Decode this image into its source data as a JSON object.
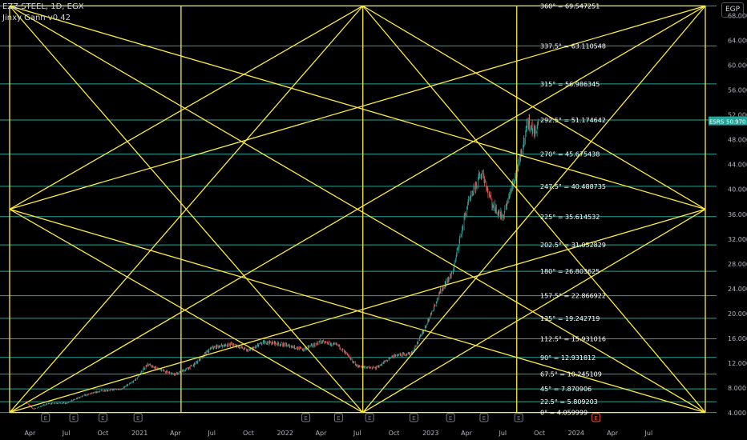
{
  "header": {
    "symbol_line": "EZZ STEEL, 1D, EGX",
    "indicator_name": "Jinxy Gann v0.42",
    "currency_button": "EGP"
  },
  "price_label": {
    "tag": "ESRS",
    "value": "50.970"
  },
  "colors": {
    "background": "#000000",
    "gann_lines": "#ffeb3b",
    "levels": "#26a69a",
    "candle_up": "#26a69a",
    "candle_down": "#ef5350",
    "label_bg": "#26a69a",
    "earnings_marker": "#787b86",
    "earnings_marker_future": "#ef5350"
  },
  "chart_data": {
    "type": "candlestick",
    "title": "EZZ STEEL, 1D, EGX",
    "ylabel": "EGP",
    "y_axis_ticks": [
      "4.000",
      "8.000",
      "12.000",
      "16.000",
      "20.000",
      "24.000",
      "28.000",
      "32.000",
      "36.000",
      "40.000",
      "44.000",
      "48.000",
      "52.000",
      "56.000",
      "60.000",
      "64.000",
      "68.000"
    ],
    "x_axis_ticks": [
      "Apr",
      "Jul",
      "Oct",
      "2021",
      "Apr",
      "Jul",
      "Oct",
      "2022",
      "Apr",
      "Jul",
      "Oct",
      "2023",
      "Apr",
      "Jul",
      "Oct",
      "2024",
      "Apr",
      "Jul"
    ],
    "ylim": [
      3.5,
      70.5
    ],
    "grid": false,
    "gann_levels": [
      {
        "label": "0° = 4.059999",
        "value": 4.06
      },
      {
        "label": "22.5° = 5.809203",
        "value": 5.81
      },
      {
        "label": "45° = 7.870906",
        "value": 7.87
      },
      {
        "label": "67.5° = 10.245109",
        "value": 10.25
      },
      {
        "label": "90° = 12.931812",
        "value": 12.93
      },
      {
        "label": "112.5° = 15.931016",
        "value": 15.93
      },
      {
        "label": "135° = 19.242719",
        "value": 19.24
      },
      {
        "label": "157.5° = 22.866922",
        "value": 22.87
      },
      {
        "label": "180° = 26.803625",
        "value": 26.8
      },
      {
        "label": "202.5° = 31.052829",
        "value": 31.05
      },
      {
        "label": "225° = 35.614532",
        "value": 35.61
      },
      {
        "label": "247.5° = 40.488735",
        "value": 40.49
      },
      {
        "label": "270° = 45.675438",
        "value": 45.68
      },
      {
        "label": "292.5° = 51.174642",
        "value": 51.17
      },
      {
        "label": "315° = 56.986345",
        "value": 56.99
      },
      {
        "label": "337.5° = 63.110548",
        "value": 63.11
      },
      {
        "label": "360° = 69.547251",
        "value": 69.55
      }
    ],
    "price_path": [
      [
        "2020-03-20",
        5.8
      ],
      [
        "2020-04-10",
        4.6
      ],
      [
        "2020-05-15",
        5.5
      ],
      [
        "2020-07-01",
        5.6
      ],
      [
        "2020-08-15",
        6.8
      ],
      [
        "2020-10-01",
        7.6
      ],
      [
        "2020-11-15",
        7.8
      ],
      [
        "2020-12-20",
        9.2
      ],
      [
        "2021-01-20",
        11.8
      ],
      [
        "2021-02-20",
        11.0
      ],
      [
        "2021-04-01",
        10.2
      ],
      [
        "2021-05-15",
        11.6
      ],
      [
        "2021-07-01",
        14.5
      ],
      [
        "2021-08-20",
        15.1
      ],
      [
        "2021-10-01",
        14.0
      ],
      [
        "2021-11-10",
        15.4
      ],
      [
        "2022-01-01",
        15.0
      ],
      [
        "2022-02-15",
        14.2
      ],
      [
        "2022-04-01",
        15.5
      ],
      [
        "2022-05-15",
        14.8
      ],
      [
        "2022-07-01",
        11.5
      ],
      [
        "2022-08-15",
        11.2
      ],
      [
        "2022-10-01",
        13.2
      ],
      [
        "2022-11-15",
        13.6
      ],
      [
        "2022-12-20",
        18.0
      ],
      [
        "2023-01-25",
        23.5
      ],
      [
        "2023-02-25",
        26.5
      ],
      [
        "2023-04-01",
        37.0
      ],
      [
        "2023-05-10",
        43.0
      ],
      [
        "2023-06-05",
        37.5
      ],
      [
        "2023-07-01",
        35.5
      ],
      [
        "2023-07-20",
        39.5
      ],
      [
        "2023-08-15",
        45.0
      ],
      [
        "2023-09-01",
        51.0
      ],
      [
        "2023-09-20",
        49.0
      ],
      [
        "2023-09-28",
        50.97
      ]
    ],
    "earnings_events": [
      "2020-05-10",
      "2020-07-20",
      "2020-10-01",
      "2020-12-28",
      "2022-02-22",
      "2022-05-15",
      "2022-08-01",
      "2022-11-20",
      "2023-02-20",
      "2023-05-15",
      "2023-08-10",
      "2024-02-20"
    ],
    "gann_time_pivots": [
      "2020-02-10",
      "2022-07-15",
      "2024-11-20"
    ],
    "gann_extra_verticals": [
      "2021-04-15",
      "2023-08-05"
    ],
    "gann_price_pivots": [
      4.06,
      36.8,
      69.55
    ]
  }
}
